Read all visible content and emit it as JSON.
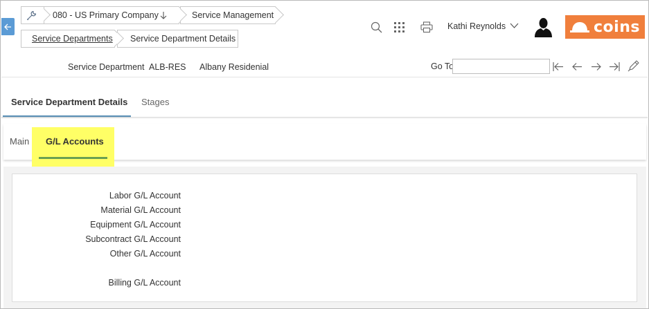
{
  "breadcrumbs": {
    "company": "080 - US Primary Company",
    "module": "Service Management",
    "list": "Service Departments",
    "detail": "Service Department Details"
  },
  "header": {
    "user_name": "Kathi Reynolds",
    "logo_text": "coins",
    "brand_color": "#f07f3c",
    "icons": [
      "wrench-icon",
      "search-icon",
      "apps-grid-icon",
      "print-icon",
      "user-avatar-icon"
    ]
  },
  "record": {
    "label": "Service Department",
    "code": "ALB-RES",
    "name": "Albany Residenial",
    "goto_label": "Go To",
    "goto_value": ""
  },
  "tabs": [
    {
      "label": "Service Department Details",
      "active": true
    },
    {
      "label": "Stages",
      "active": false
    }
  ],
  "subtabs": [
    {
      "label": "Main",
      "active": false
    },
    {
      "label": "G/L Accounts",
      "active": true
    }
  ],
  "form": {
    "fields": [
      {
        "label": "Labor G/L Account"
      },
      {
        "label": "Material G/L Account"
      },
      {
        "label": "Equipment G/L Account"
      },
      {
        "label": "Subcontract G/L Account"
      },
      {
        "label": "Other G/L Account"
      },
      {
        "label": "Billing G/L Account"
      }
    ]
  },
  "colors": {
    "accent_blue": "#5a8fb5",
    "subtab_underline": "#6aa051",
    "highlight": "#ffff66"
  }
}
